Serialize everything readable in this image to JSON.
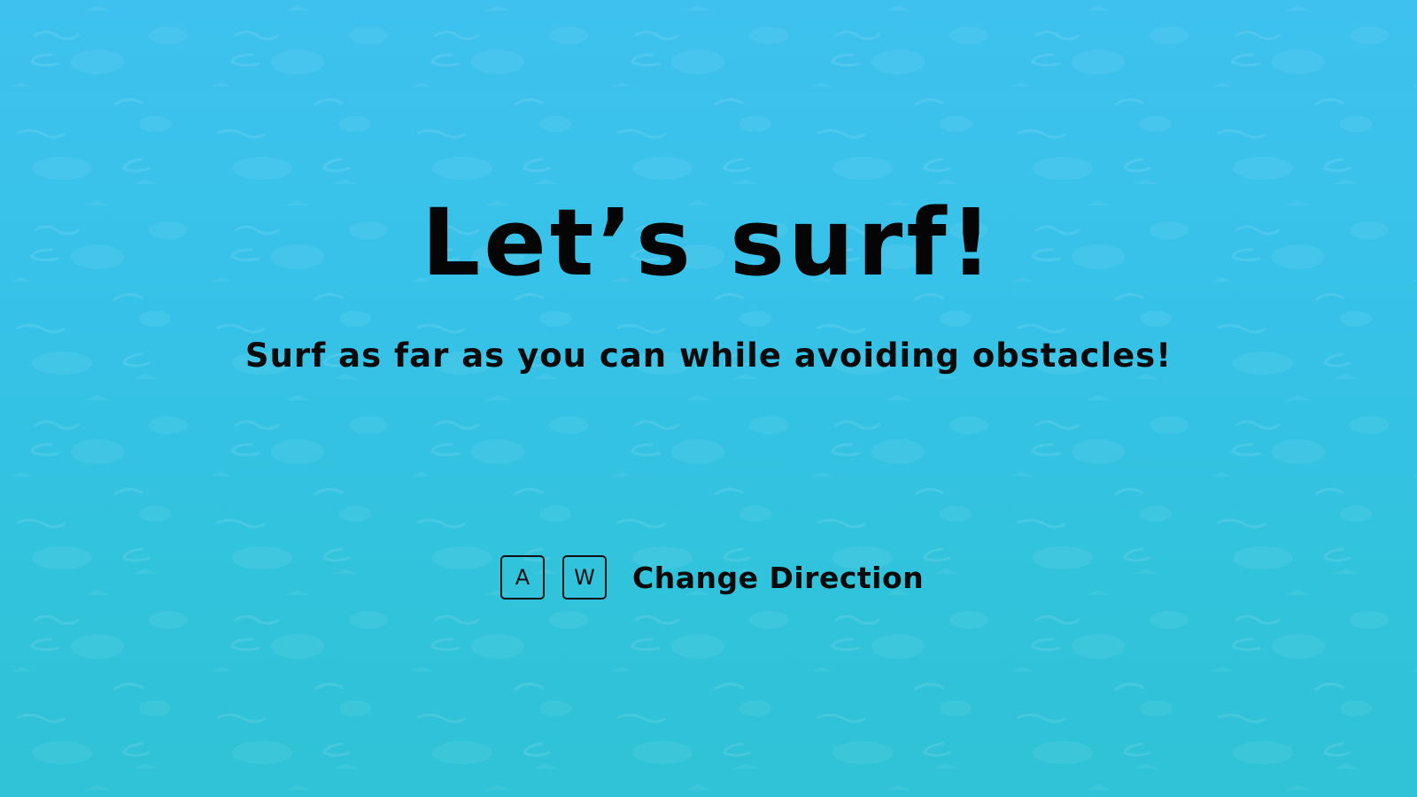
{
  "screen": {
    "title": "Let’s surf!",
    "subtitle": "Surf as far as you can while avoiding obstacles!"
  },
  "controls": [
    {
      "keys": [
        "A",
        "W"
      ],
      "action": "Change Direction"
    }
  ],
  "colors": {
    "water_top": "#3ec1ee",
    "water_bottom": "#30c2d6",
    "text": "#050505"
  }
}
